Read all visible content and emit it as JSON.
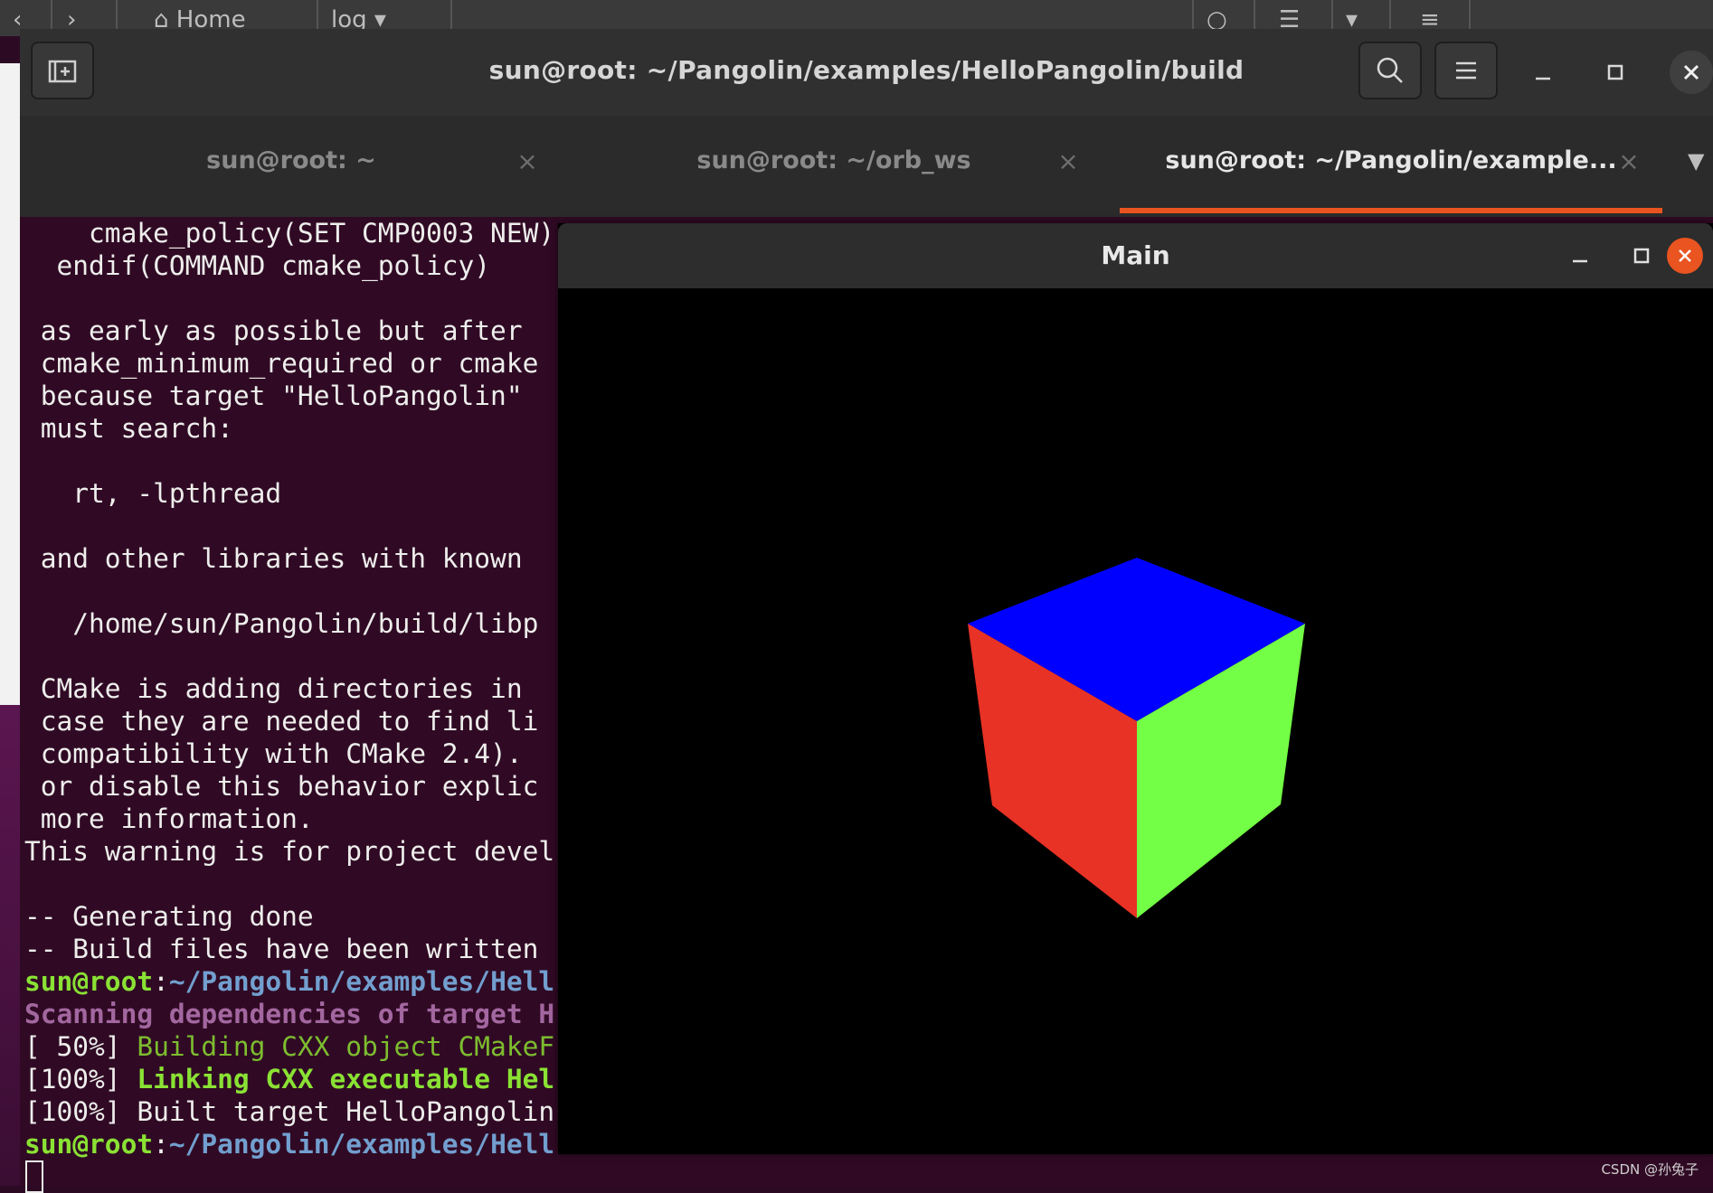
{
  "background_window": {
    "home_label": "Home",
    "log_label": "log"
  },
  "terminal": {
    "title": "sun@root: ~/Pangolin/examples/HelloPangolin/build",
    "tabs": [
      {
        "label": "sun@root: ~",
        "active": false
      },
      {
        "label": "sun@root: ~/orb_ws",
        "active": false
      },
      {
        "label": "sun@root: ~/Pangolin/example...",
        "active": true
      }
    ],
    "output": {
      "l1": "    cmake_policy(SET CMP0003 NEW)",
      "l2": "  endif(COMMAND cmake_policy)",
      "l3": " as early as possible but after",
      "l4": " cmake_minimum_required or cmake",
      "l5": " because target \"HelloPangolin\"",
      "l6": " must search:",
      "l7": "   rt, -lpthread",
      "l8": " and other libraries with known",
      "l9": "   /home/sun/Pangolin/build/libp",
      "l10": " CMake is adding directories in",
      "l11": " case they are needed to find li",
      "l12": " compatibility with CMake 2.4).",
      "l13": " or disable this behavior explic",
      "l14": " more information.",
      "l15": "This warning is for project devel",
      "l16": "-- Generating done",
      "l17": "-- Build files have been written",
      "prompt_user": "sun@root",
      "prompt_sep": ":",
      "prompt_path": "~/Pangolin/examples/Hell",
      "l19": "Scanning dependencies of target H",
      "l20_prefix": "[ 50%] ",
      "l20_msg": "Building CXX object CMakeF",
      "l21_prefix": "[100%] ",
      "l21_msg": "Linking CXX executable Hel",
      "l22": "[100%] Built target HelloPangolin"
    }
  },
  "pangolin_window": {
    "title": "Main",
    "cube_colors": {
      "top": "#0000ff",
      "left": "#e83225",
      "right": "#73ff45"
    }
  },
  "watermark": "CSDN @孙兔子"
}
